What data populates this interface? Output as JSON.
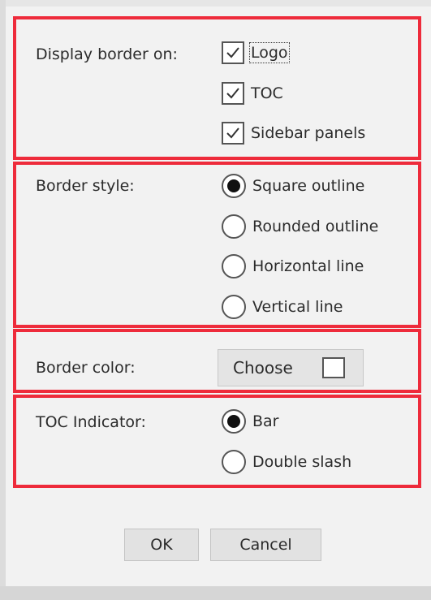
{
  "display_border": {
    "label": "Display border on:",
    "options": [
      {
        "label": "Logo",
        "checked": true
      },
      {
        "label": "TOC",
        "checked": true
      },
      {
        "label": "Sidebar panels",
        "checked": true
      }
    ]
  },
  "border_style": {
    "label": "Border style:",
    "options": [
      {
        "label": "Square outline",
        "selected": true
      },
      {
        "label": "Rounded outline",
        "selected": false
      },
      {
        "label": "Horizontal line",
        "selected": false
      },
      {
        "label": "Vertical line",
        "selected": false
      }
    ]
  },
  "border_color": {
    "label": "Border color:",
    "button_label": "Choose",
    "swatch_color": "#ffffff"
  },
  "toc_indicator": {
    "label": "TOC Indicator:",
    "options": [
      {
        "label": "Bar",
        "selected": true
      },
      {
        "label": "Double slash",
        "selected": false
      }
    ]
  },
  "buttons": {
    "ok": "OK",
    "cancel": "Cancel"
  },
  "colors": {
    "highlight_border": "#ee2b3b",
    "dialog_bg": "#f2f2f2"
  }
}
